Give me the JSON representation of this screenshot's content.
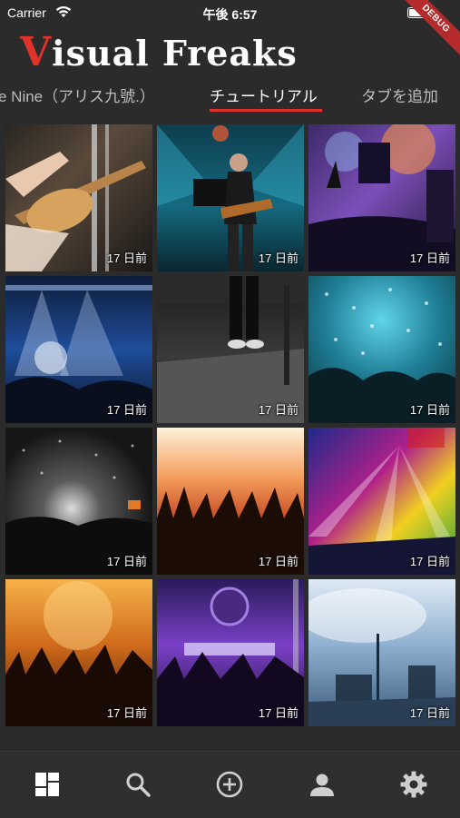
{
  "status_bar": {
    "carrier": "Carrier",
    "time": "午後 6:57",
    "debug_banner": "DEBUG"
  },
  "header": {
    "title_first": "V",
    "title_rest": "isual Freaks",
    "accent_color": "#e0312b"
  },
  "tabs": [
    {
      "label": "e Nine（アリス九號.）",
      "active": false
    },
    {
      "label": "チュートリアル",
      "active": true
    },
    {
      "label": "タブを追加",
      "active": false
    }
  ],
  "grid": {
    "items": [
      {
        "time": "17 日前",
        "scene": "bassist-closeup"
      },
      {
        "time": "17 日前",
        "scene": "guitarist-blue-stage"
      },
      {
        "time": "17 日前",
        "scene": "purple-stage-silhouette"
      },
      {
        "time": "17 日前",
        "scene": "blue-light-rig"
      },
      {
        "time": "17 日前",
        "scene": "bw-stage-performer"
      },
      {
        "time": "17 日前",
        "scene": "confetti-crowd-teal"
      },
      {
        "time": "17 日前",
        "scene": "dark-confetti-crowd"
      },
      {
        "time": "17 日前",
        "scene": "orange-crowd-hands"
      },
      {
        "time": "17 日前",
        "scene": "rainbow-lasers"
      },
      {
        "time": "17 日前",
        "scene": "orange-haze-crowd"
      },
      {
        "time": "17 日前",
        "scene": "purple-stage-crowd"
      },
      {
        "time": "17 日前",
        "scene": "blue-smoke-stage"
      }
    ]
  },
  "bottom_nav": [
    {
      "icon": "dashboard-icon",
      "active": true
    },
    {
      "icon": "search-icon",
      "active": false
    },
    {
      "icon": "add-circle-icon",
      "active": false
    },
    {
      "icon": "person-icon",
      "active": false
    },
    {
      "icon": "settings-gear-icon",
      "active": false
    }
  ]
}
